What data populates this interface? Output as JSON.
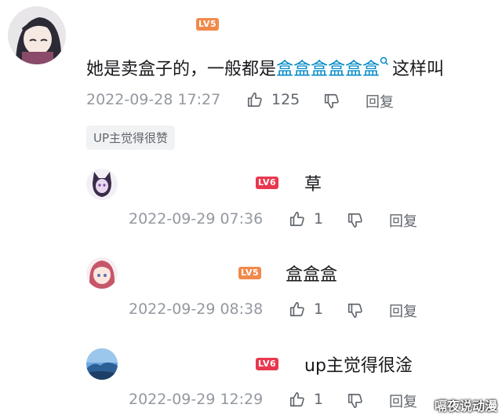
{
  "main_comment": {
    "level": "LV5",
    "text_before": "她是卖盒子的，一般都是",
    "link_text": "盒盒盒盒盒盒",
    "text_after": "这样叫",
    "time": "2022-09-28 17:27",
    "likes": "125",
    "reply_label": "回复",
    "tag": "UP主觉得很赞"
  },
  "replies": [
    {
      "level": "LV6",
      "text": "草",
      "time": "2022-09-29 07:36",
      "likes": "1",
      "reply_label": "回复"
    },
    {
      "level": "LV5",
      "text": "盒盒盒",
      "time": "2022-09-29 08:38",
      "likes": "1",
      "reply_label": "回复"
    },
    {
      "level": "LV6",
      "text": "up主觉得很淦",
      "time": "2022-09-29 12:29",
      "likes": "1",
      "reply_label": "回复"
    }
  ],
  "watermark": "嗝夜说动漫",
  "colors": {
    "link": "#008ac5",
    "lv5": "#f08a4b",
    "lv6": "#e8384f",
    "meta": "#9499a0"
  }
}
